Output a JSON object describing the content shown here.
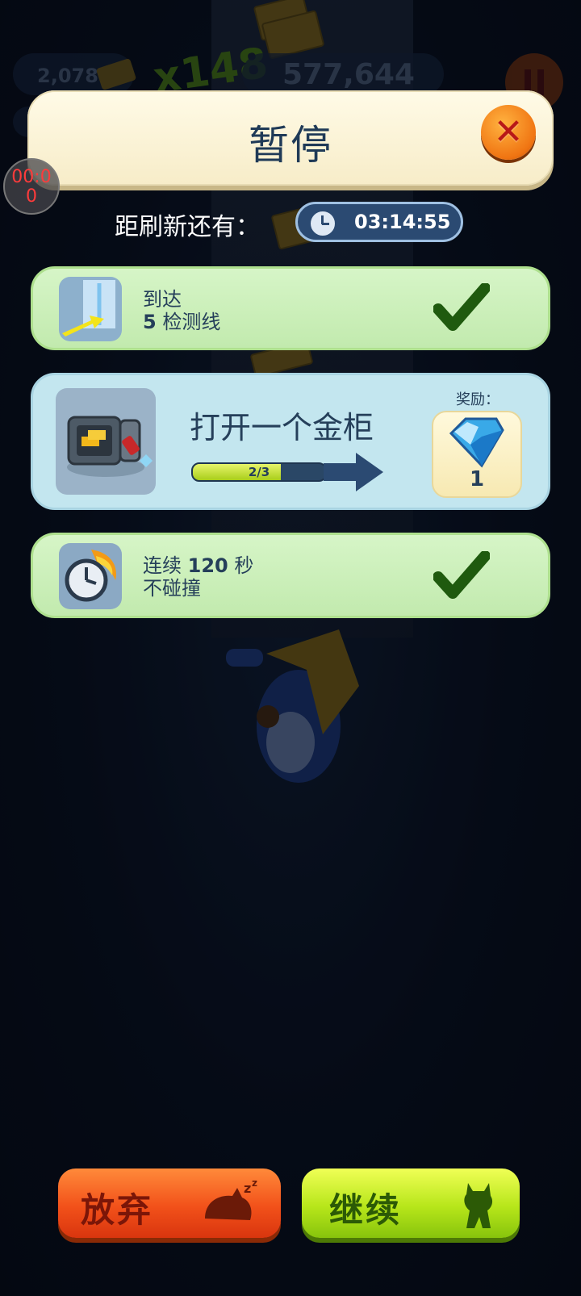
{
  "hud": {
    "gold_count": "2,078",
    "multiplier": "x148",
    "score": "577,644"
  },
  "recorder": {
    "time": "00:0\n0"
  },
  "dialog": {
    "title": "暂停",
    "refresh_label": "距刷新还有：",
    "refresh_time": "03:14:55"
  },
  "tasks": [
    {
      "line1": "到达",
      "line2_num": "5",
      "line2_text": " 检测线",
      "status": "completed",
      "icon": "checkpoint-line-icon"
    },
    {
      "title": "打开一个金柜",
      "progress_label": "2/3",
      "progress": 0.6667,
      "reward_label": "奖励：",
      "reward_count": "1",
      "reward_icon": "diamond-icon",
      "icon": "safe-icon"
    },
    {
      "line1_text": "连续 ",
      "line1_num": "120",
      "line1_suffix": " 秒",
      "line2": "不碰撞",
      "status": "completed",
      "icon": "flaming-clock-icon"
    }
  ],
  "buttons": {
    "quit_label": "放弃",
    "continue_label": "继续"
  },
  "colors": {
    "quit": "#f2511a",
    "continue": "#b7e61a",
    "task_done": "#c2eaae",
    "task_active": "#c3e6ef",
    "title_text": "#1f3a57"
  }
}
